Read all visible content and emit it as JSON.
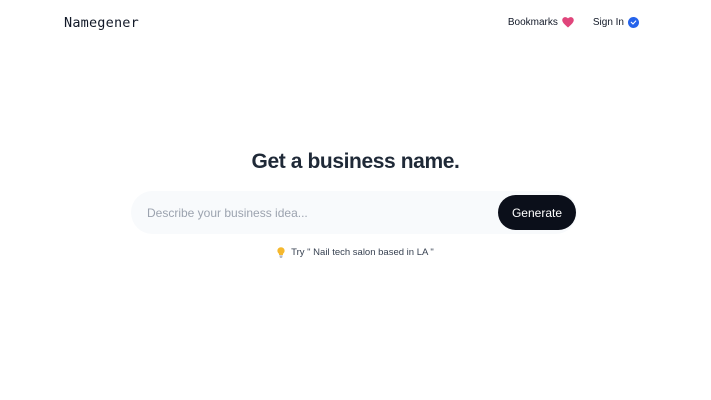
{
  "header": {
    "logo": "Namegener",
    "bookmarks_label": "Bookmarks",
    "signin_label": "Sign In"
  },
  "hero": {
    "title": "Get a business name."
  },
  "search": {
    "placeholder": "Describe your business idea...",
    "value": "",
    "button_label": "Generate"
  },
  "suggestion": {
    "text": "Try \" Nail tech salon based in LA \""
  },
  "colors": {
    "heart": "#e0457b",
    "signin_check": "#2563eb",
    "button_bg": "#0b0f1a",
    "search_bg": "#f8fafc",
    "bulb": "#f5b82e"
  }
}
